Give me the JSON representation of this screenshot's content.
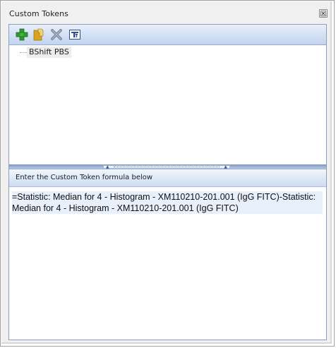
{
  "window": {
    "title": "Custom Tokens"
  },
  "toolbar": {
    "buttons": [
      {
        "name": "add",
        "icon": "plus-icon",
        "color": "#2f9a2f"
      },
      {
        "name": "open",
        "icon": "folder-icon",
        "color": "#d9a520"
      },
      {
        "name": "delete",
        "icon": "delete-x-icon",
        "color": "#7f8a9c"
      },
      {
        "name": "text",
        "icon": "text-format-icon",
        "color": "#2a4f8a"
      }
    ]
  },
  "tree": {
    "items": [
      {
        "label": "BShift PBS"
      }
    ]
  },
  "formula": {
    "header": "Enter the Custom Token formula below",
    "value": "=Statistic: Median for 4 - Histogram - XM110210-201.001 (IgG FITC)-Statistic: Median for 4 - Histogram - XM110210-201.001 (IgG FITC)"
  },
  "colors": {
    "toolbar_bg": "#d4e1f5",
    "splitter": "#8ba4c9",
    "selection": "#e8f0fb"
  }
}
